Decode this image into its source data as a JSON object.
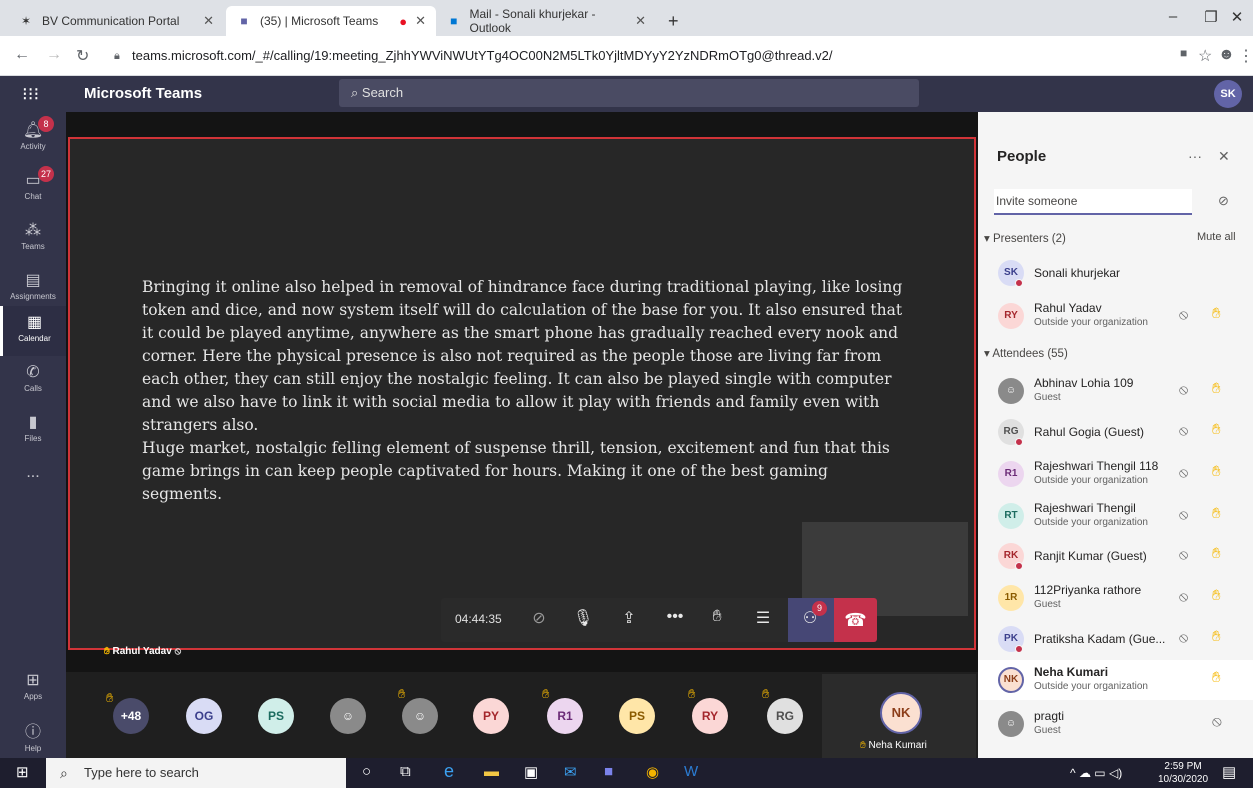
{
  "browser": {
    "tabs": [
      {
        "title": "BV Communication Portal",
        "icon": "bv-portal-icon"
      },
      {
        "title": "(35) | Microsoft Teams",
        "icon": "teams-icon"
      },
      {
        "title": "Mail - Sonali khurjekar - Outlook",
        "icon": "outlook-icon"
      }
    ],
    "url": "teams.microsoft.com/_#/calling/19:meeting_ZjhhYWViNWUtYTg4OC00N2M5LTk0YjltMDYyY2YzNDRmOTg0@thread.v2/"
  },
  "teams": {
    "brand": "Microsoft Teams",
    "search_placeholder": "Search",
    "user_initials": "SK"
  },
  "rail": [
    {
      "label": "Activity",
      "badge": "8",
      "icon": "bell-icon"
    },
    {
      "label": "Chat",
      "badge": "27",
      "icon": "chat-icon"
    },
    {
      "label": "Teams",
      "badge": "",
      "icon": "teams-icon"
    },
    {
      "label": "Assignments",
      "badge": "",
      "icon": "assignments-icon"
    },
    {
      "label": "Calendar",
      "badge": "",
      "icon": "calendar-icon"
    },
    {
      "label": "Calls",
      "badge": "",
      "icon": "phone-icon"
    },
    {
      "label": "Files",
      "badge": "",
      "icon": "file-icon"
    },
    {
      "label": "...",
      "badge": "",
      "icon": "more-icon"
    },
    {
      "label": "Apps",
      "badge": "",
      "icon": "apps-icon"
    },
    {
      "label": "Help",
      "badge": "",
      "icon": "help-icon"
    }
  ],
  "share": {
    "paragraphs": [
      "Bringing it online also helped in removal of hindrance face during traditional playing, like losing token and dice, and now system itself will do calculation of the base for you. It also ensured that it could be played anytime, anywhere as the smart phone has gradually reached every nook and corner. Here the physical presence is also not required as the people those are living far from each other, they can still enjoy the nostalgic feeling. It can also be played single with computer and we also have to link it with social media to allow it play with friends and family even with strangers also.",
      "Huge market, nostalgic felling element of suspense thrill, tension, excitement and fun that this game brings in can keep people captivated for hours. Making it one of the best gaming segments."
    ],
    "presenter": "Rahul Yadav"
  },
  "controls": {
    "timer": "04:44:35",
    "people_badge": "9"
  },
  "strip": {
    "more": "+48",
    "avatars": [
      "OG",
      "PS",
      "",
      "",
      "PY",
      "R1",
      "PS",
      "RY",
      "RG"
    ],
    "featured_initials": "NK",
    "featured_name": "Neha Kumari"
  },
  "panel": {
    "title": "People",
    "invite_placeholder": "Invite someone",
    "presenters_header": "Presenters (2)",
    "mute_all": "Mute all",
    "attendees_header": "Attendees (55)",
    "presenters": [
      {
        "initials": "SK",
        "name": "Sonali khurjekar",
        "sub": ""
      },
      {
        "initials": "RY",
        "name": "Rahul Yadav",
        "sub": "Outside your organization"
      }
    ],
    "attendees": [
      {
        "initials": "",
        "name": "Abhinav Lohia 109",
        "sub": "Guest"
      },
      {
        "initials": "RG",
        "name": "Rahul Gogia (Guest)",
        "sub": ""
      },
      {
        "initials": "R1",
        "name": "Rajeshwari Thengil 118",
        "sub": "Outside your organization"
      },
      {
        "initials": "RT",
        "name": "Rajeshwari Thengil",
        "sub": "Outside your organization"
      },
      {
        "initials": "RK",
        "name": "Ranjit Kumar (Guest)",
        "sub": ""
      },
      {
        "initials": "1R",
        "name": "112Priyanka rathore",
        "sub": "Guest"
      },
      {
        "initials": "PK",
        "name": "Pratiksha Kadam (Gue...",
        "sub": ""
      },
      {
        "initials": "NK",
        "name": "Neha Kumari",
        "sub": "Outside your organization"
      },
      {
        "initials": "",
        "name": "pragti",
        "sub": "Guest"
      }
    ]
  },
  "taskbar": {
    "search_placeholder": "Type here to search",
    "time": "2:59 PM",
    "date": "10/30/2020"
  }
}
